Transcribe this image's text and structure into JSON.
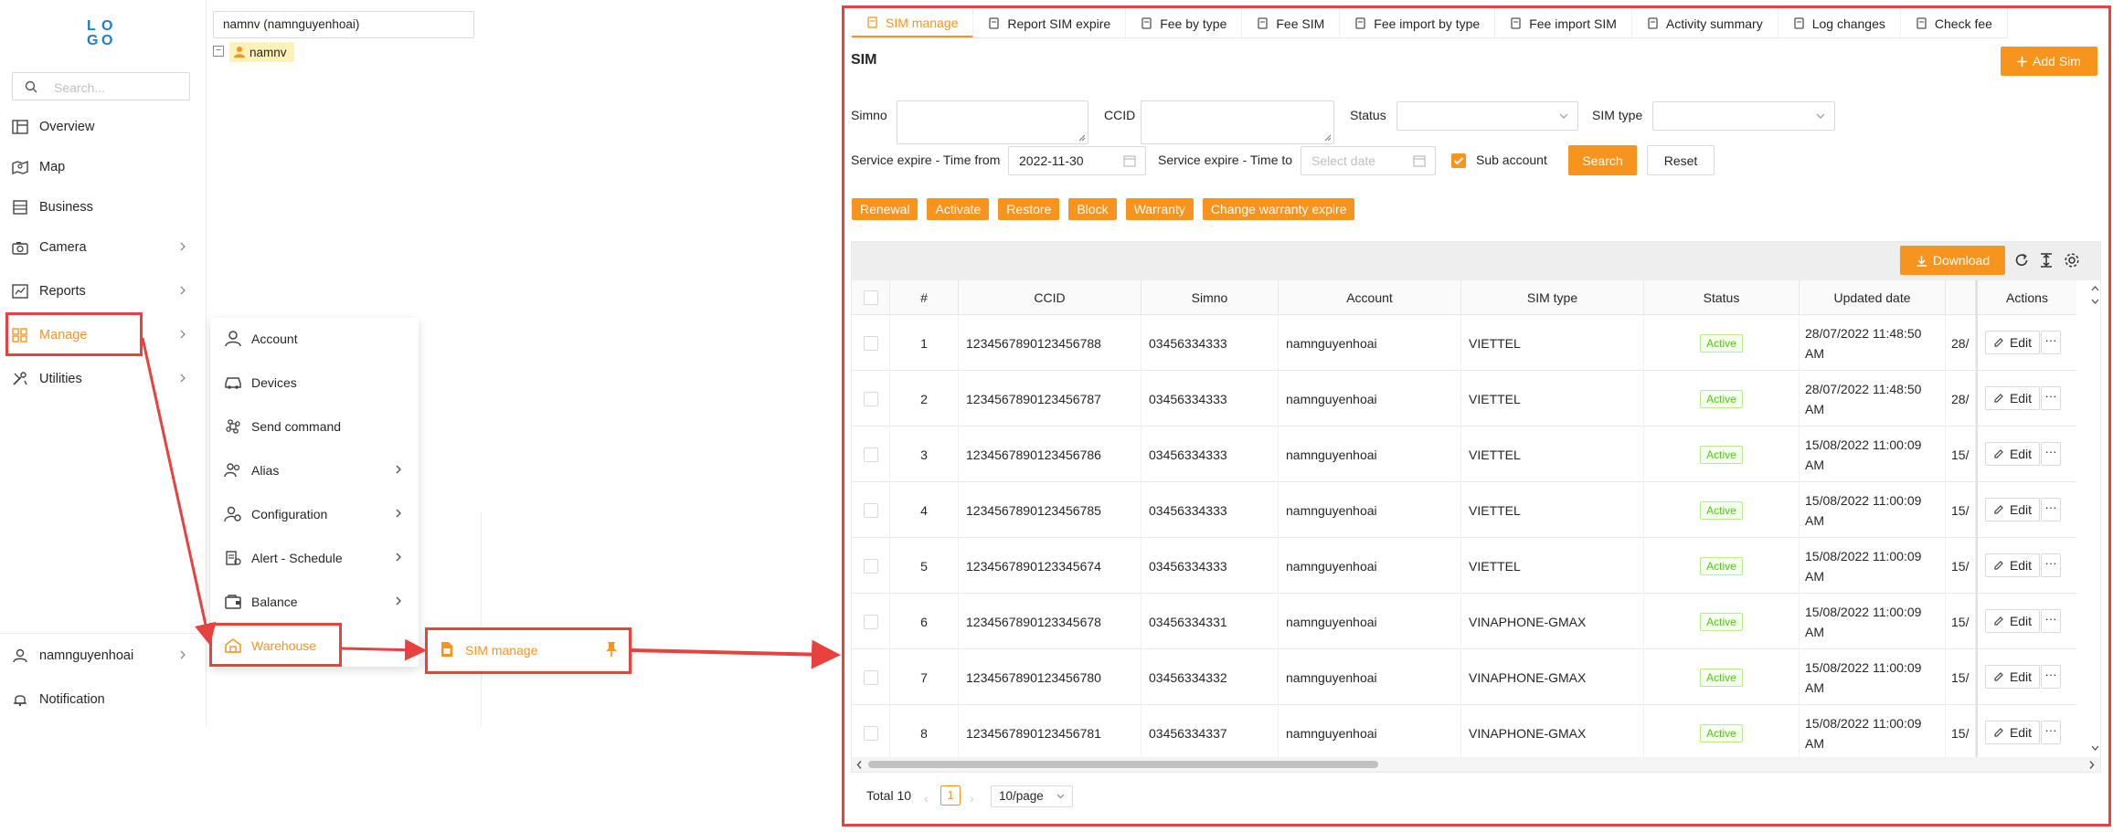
{
  "sidebar": {
    "logo_letters": [
      "L",
      "G",
      "O",
      "O"
    ],
    "search_placeholder": "Search...",
    "items": [
      {
        "label": "Overview",
        "icon": "overview-icon"
      },
      {
        "label": "Map",
        "icon": "map-icon"
      },
      {
        "label": "Business",
        "icon": "business-icon"
      },
      {
        "label": "Camera",
        "icon": "camera-icon"
      },
      {
        "label": "Reports",
        "icon": "reports-icon"
      },
      {
        "label": "Manage",
        "icon": "manage-icon"
      },
      {
        "label": "Utilities",
        "icon": "utilities-icon"
      }
    ],
    "user": "namnguyenhoai",
    "notification": "Notification"
  },
  "tree": {
    "search_value": "namnv (namnguyenhoai)",
    "toggle": "−",
    "node": "namnv"
  },
  "submenu": {
    "items": [
      "Account",
      "Devices",
      "Send command",
      "Alias",
      "Configuration",
      "Alert - Schedule",
      "Balance",
      "Warehouse"
    ]
  },
  "flyout": {
    "label": "SIM manage"
  },
  "tabs": [
    "SIM manage",
    "Report SIM expire",
    "Fee by type",
    "Fee SIM",
    "Fee import by type",
    "Fee import SIM",
    "Activity summary",
    "Log changes",
    "Check fee"
  ],
  "page": {
    "title": "SIM",
    "add_button": "Add Sim"
  },
  "filters": {
    "simno_label": "Simno",
    "ccid_label": "CCID",
    "status_label": "Status",
    "simtype_label": "SIM type",
    "time_from_label": "Service expire - Time from",
    "time_from_value": "2022-11-30",
    "time_to_label": "Service expire - Time to",
    "time_to_placeholder": "Select date",
    "sub_account_label": "Sub account",
    "search_button": "Search",
    "reset_button": "Reset"
  },
  "actions": [
    "Renewal",
    "Activate",
    "Restore",
    "Block",
    "Warranty",
    "Change warranty expire"
  ],
  "table": {
    "download_button": "Download",
    "columns": [
      "#",
      "CCID",
      "Simno",
      "Account",
      "SIM type",
      "Status",
      "Updated date",
      "Actions"
    ],
    "edit_label": "Edit",
    "more_label": "···",
    "rows": [
      {
        "no": "1",
        "ccid": "1234567890123456788",
        "simno": "03456334333",
        "account": "namnguyenhoai",
        "simtype": "VIETTEL",
        "status": "Active",
        "updated": "28/07/2022 11:48:50 AM",
        "extra": "28/"
      },
      {
        "no": "2",
        "ccid": "1234567890123456787",
        "simno": "03456334333",
        "account": "namnguyenhoai",
        "simtype": "VIETTEL",
        "status": "Active",
        "updated": "28/07/2022 11:48:50 AM",
        "extra": "28/"
      },
      {
        "no": "3",
        "ccid": "1234567890123456786",
        "simno": "03456334333",
        "account": "namnguyenhoai",
        "simtype": "VIETTEL",
        "status": "Active",
        "updated": "15/08/2022 11:00:09 AM",
        "extra": "15/"
      },
      {
        "no": "4",
        "ccid": "1234567890123456785",
        "simno": "03456334333",
        "account": "namnguyenhoai",
        "simtype": "VIETTEL",
        "status": "Active",
        "updated": "15/08/2022 11:00:09 AM",
        "extra": "15/"
      },
      {
        "no": "5",
        "ccid": "1234567890123345674",
        "simno": "03456334333",
        "account": "namnguyenhoai",
        "simtype": "VIETTEL",
        "status": "Active",
        "updated": "15/08/2022 11:00:09 AM",
        "extra": "15/"
      },
      {
        "no": "6",
        "ccid": "1234567890123345678",
        "simno": "03456334331",
        "account": "namnguyenhoai",
        "simtype": "VINAPHONE-GMAX",
        "status": "Active",
        "updated": "15/08/2022 11:00:09 AM",
        "extra": "15/"
      },
      {
        "no": "7",
        "ccid": "1234567890123456780",
        "simno": "03456334332",
        "account": "namnguyenhoai",
        "simtype": "VINAPHONE-GMAX",
        "status": "Active",
        "updated": "15/08/2022 11:00:09 AM",
        "extra": "15/"
      },
      {
        "no": "8",
        "ccid": "1234567890123456781",
        "simno": "03456334337",
        "account": "namnguyenhoai",
        "simtype": "VINAPHONE-GMAX",
        "status": "Active",
        "updated": "15/08/2022 11:00:09 AM",
        "extra": "15/"
      }
    ]
  },
  "pagination": {
    "total": "Total 10",
    "page": "1",
    "page_size": "10/page",
    "prev": "‹",
    "next": "›"
  },
  "colors": {
    "accent": "#f7941d",
    "annotation": "#e8423f",
    "active_badge": "#52c41a"
  }
}
